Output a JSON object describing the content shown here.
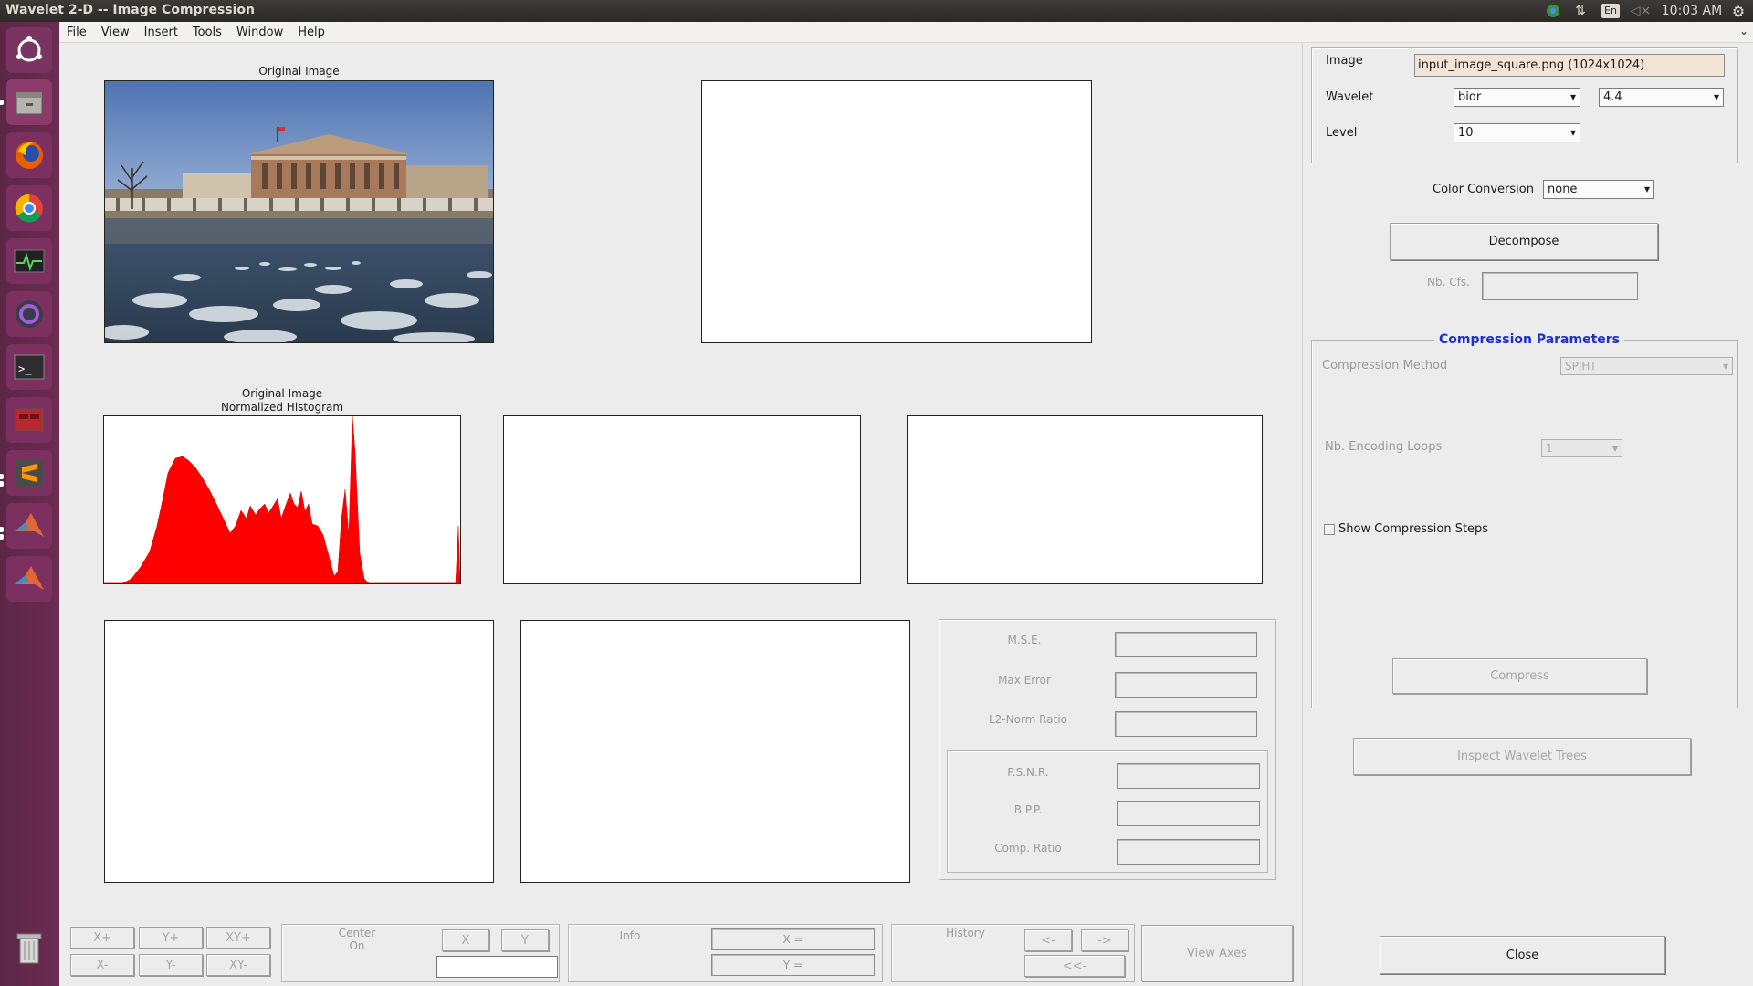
{
  "window": {
    "title": "Wavelet 2-D -- Image Compression"
  },
  "topbar": {
    "keyboard": "En",
    "clock": "10:03 AM",
    "icons": [
      "chrome-tray-icon",
      "network-icon",
      "keyboard-icon",
      "volume-muted-icon",
      "gear-icon"
    ]
  },
  "launcher": {
    "items": [
      "ubuntu-dash",
      "files",
      "firefox",
      "chrome",
      "system-monitor",
      "obs",
      "terminal",
      "app-red",
      "sublime-text",
      "matlab",
      "matlab"
    ]
  },
  "menu": [
    "File",
    "View",
    "Insert",
    "Tools",
    "Window",
    "Help"
  ],
  "axes": {
    "original_title": "Original Image",
    "hist_title_1": "Original Image",
    "hist_title_2": "Normalized Histogram"
  },
  "controls": {
    "image_label": "Image",
    "image_value": "input_image_square.png  (1024x1024)",
    "wavelet_label": "Wavelet",
    "wavelet_family": "bior",
    "wavelet_number": "4.4",
    "level_label": "Level",
    "level_value": "10",
    "color_conversion_label": "Color Conversion",
    "color_conversion_value": "none",
    "decompose": "Decompose",
    "nb_cfs": "Nb. Cfs.",
    "compression_params_title": "Compression Parameters",
    "compression_method_label": "Compression Method",
    "compression_method_value": "SPIHT",
    "encoding_loops_label": "Nb. Encoding Loops",
    "encoding_loops_value": "1",
    "show_steps": "Show Compression Steps",
    "compress": "Compress",
    "inspect": "Inspect Wavelet Trees",
    "close": "Close"
  },
  "stats": {
    "mse": "M.S.E.",
    "max_error": "Max Error",
    "l2_ratio": "L2-Norm Ratio",
    "psnr": "P.S.N.R.",
    "bpp": "B.P.P.",
    "comp_ratio": "Comp. Ratio"
  },
  "bottom": {
    "xplus": "X+",
    "yplus": "Y+",
    "xyplus": "XY+",
    "xminus": "X-",
    "yminus": "Y-",
    "xyminus": "XY-",
    "center_on_1": "Center",
    "center_on_2": "On",
    "x": "X",
    "y": "Y",
    "info": "Info",
    "x_eq": "X =",
    "y_eq": "Y =",
    "history": "History",
    "back": "<-",
    "fwd": "->",
    "back_all": "<<-",
    "view_axes": "View Axes"
  }
}
